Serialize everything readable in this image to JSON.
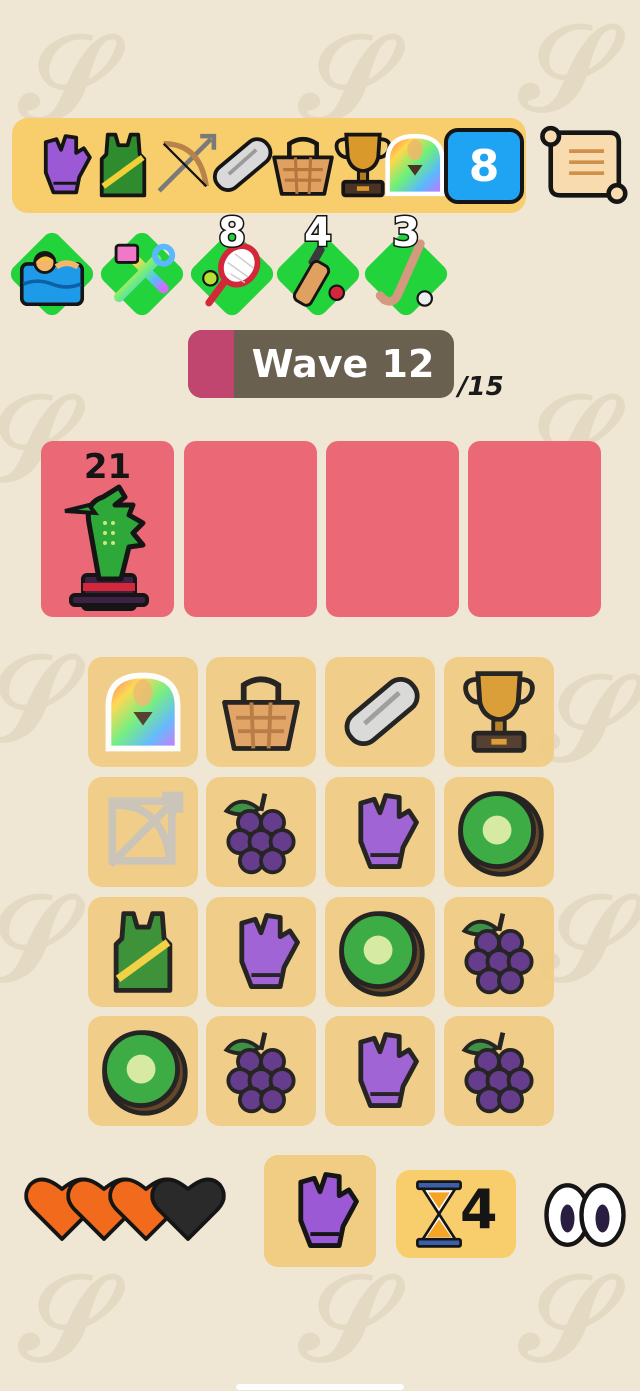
{
  "inventory": {
    "items": [
      {
        "icon": "purple-glove-icon"
      },
      {
        "icon": "green-jersey-icon"
      },
      {
        "icon": "bow-arrow-icon"
      },
      {
        "icon": "newspaper-icon"
      },
      {
        "icon": "basket-icon"
      },
      {
        "icon": "trophy-icon"
      },
      {
        "icon": "rainbow-idol-icon"
      }
    ],
    "count": "8"
  },
  "perks": [
    {
      "icon": "swimmer-icon",
      "count": ""
    },
    {
      "icon": "tools-icon",
      "count": ""
    },
    {
      "icon": "tennis-racket-icon",
      "count": "8"
    },
    {
      "icon": "cricket-bat-icon",
      "count": "4"
    },
    {
      "icon": "hockey-stick-icon",
      "count": "3"
    }
  ],
  "wave": {
    "label": "Wave 12",
    "total": "/15",
    "current": 12,
    "max": 15
  },
  "lanes": [
    {
      "enemy": "crocodile-top-hat-icon",
      "hp": "21"
    },
    {
      "enemy": null
    },
    {
      "enemy": null
    },
    {
      "enemy": null
    }
  ],
  "board": [
    [
      "rainbow-idol-icon",
      "basket-icon",
      "newspaper-icon",
      "trophy-icon"
    ],
    [
      "bow-arrow-ghost-icon",
      "grapes-icon",
      "purple-glove-icon",
      "kiwi-icon"
    ],
    [
      "green-jersey-icon",
      "purple-glove-icon",
      "kiwi-icon",
      "grapes-icon"
    ],
    [
      "kiwi-icon",
      "grapes-icon",
      "purple-glove-icon",
      "grapes-icon"
    ]
  ],
  "lives": {
    "full": 3,
    "total": 4
  },
  "hand": {
    "icon": "purple-glove-icon"
  },
  "timer": {
    "icon": "hourglass-icon",
    "count": "4"
  },
  "colors": {
    "background": "#efe6d3",
    "lane": "#eb6877",
    "tile": "#f1cd83",
    "accent": "#22d33c"
  }
}
